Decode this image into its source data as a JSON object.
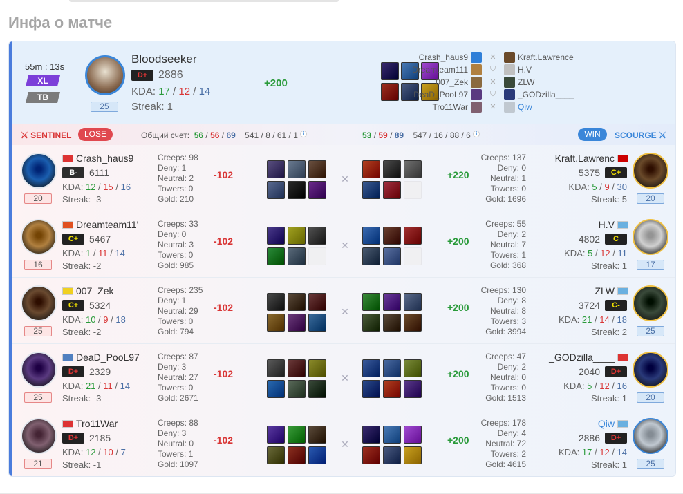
{
  "section_title": "Инфа о матче",
  "summary": {
    "duration": "55m : 13s",
    "mode_tag": "XL",
    "mode_tag_color": "#7c3fd9",
    "map_tag": "TB",
    "map_tag_color": "#7b7b7b",
    "hero_level": "25",
    "player_name": "Bloodseeker",
    "rank": "D+",
    "mmr": "2886",
    "kda_label": "KDA:",
    "kills": "17",
    "deaths": "12",
    "assists": "14",
    "streak": "Streak: 1",
    "delta": "+200",
    "item_colors": [
      "#3a2a6e",
      "#4a7ab5",
      "#a04ad0",
      "#9c3020",
      "#4a5a80",
      "#c8a020"
    ]
  },
  "players_list": {
    "left": [
      {
        "name": "Crash_haus9",
        "color": "#2f7fd8"
      },
      {
        "name": "Dreamteam111",
        "color": "#b08040"
      },
      {
        "name": "007_Zek",
        "color": "#8a6a40"
      },
      {
        "name": "DeaD_PooL97",
        "color": "#5a3a80"
      },
      {
        "name": "Tro11War",
        "color": "#806070"
      }
    ],
    "right": [
      {
        "name": "Kraft.Lawrence",
        "color": "#6a4a2a",
        "self": false
      },
      {
        "name": "H.V",
        "color": "#c0c0c0",
        "self": false
      },
      {
        "name": "ZLW",
        "color": "#3a4a3a",
        "self": false
      },
      {
        "name": "_GODzilla____",
        "color": "#2a3a7a",
        "self": false
      },
      {
        "name": "Qiw",
        "color": "#c0c8d0",
        "self": true
      }
    ]
  },
  "teambar": {
    "sentinel": "SENTINEL",
    "result_left": "LOSE",
    "score_label": "Общий счет:",
    "left_score": {
      "k": "56",
      "d": "56",
      "a": "69"
    },
    "left_totals": "541 / 8 / 61 / 1",
    "right_score": {
      "k": "53",
      "d": "59",
      "a": "89"
    },
    "right_totals": "547 / 16 / 88 / 6",
    "result_right": "WIN",
    "scourge": "SCOURGE",
    "sentinel_color": "#d93636",
    "scourge_color": "#3a86d9"
  },
  "rows": [
    {
      "left": {
        "name": "Crash_haus9",
        "rank": "B-",
        "rank_class": "rank-b",
        "mmr": "6111",
        "k": "12",
        "d": "15",
        "a": "16",
        "streak": "Streak: -3",
        "level": "20",
        "hero_color": "#1b5fb0",
        "creeps": "Creeps: 98",
        "deny": "Deny: 1",
        "neutral": "Neutral: 2",
        "towers": "Towers: 0",
        "gold": "Gold: 210",
        "delta": "-102",
        "items": [
          "#5a5080",
          "#6a7a90",
          "#6a5040",
          "#5a6a90",
          "#2a2a2a",
          "#6a2a8a"
        ],
        "flag": "#d33"
      },
      "right": {
        "name": "Kraft.Lawrenc",
        "rank": "C+",
        "rank_class": "rank-c",
        "mmr": "5375",
        "k": "5",
        "d": "9",
        "a": "30",
        "streak": "Streak: 5",
        "level": "20",
        "hero_color": "#6a4a2a",
        "creeps": "Creeps: 137",
        "deny": "Deny: 0",
        "neutral": "Neutral: 1",
        "towers": "Towers: 0",
        "gold": "Gold: 1696",
        "delta": "+220",
        "items": [
          "#b04020",
          "#4a4a4a",
          "#707070",
          "#3a5a90",
          "#a03040",
          ""
        ],
        "flag": "#c00"
      }
    },
    {
      "left": {
        "name": "Dreamteam11'",
        "rank": "C+",
        "rank_class": "rank-c",
        "mmr": "5467",
        "k": "1",
        "d": "11",
        "a": "14",
        "streak": "Streak: -2",
        "level": "16",
        "hero_color": "#b08040",
        "creeps": "Creeps: 33",
        "deny": "Deny: 0",
        "neutral": "Neutral: 3",
        "towers": "Towers: 0",
        "gold": "Gold: 985",
        "delta": "-102",
        "items": [
          "#4a3a8a",
          "#a0a020",
          "#505050",
          "#2a8a3a",
          "#5a6a7a",
          ""
        ],
        "flag": "#e05020"
      },
      "right": {
        "name": "H.V",
        "rank": "C",
        "rank_class": "rank-c",
        "mmr": "4802",
        "k": "5",
        "d": "12",
        "a": "11",
        "streak": "Streak: 1",
        "level": "17",
        "hero_color": "#d0d0d0",
        "creeps": "Creeps: 55",
        "deny": "Deny: 2",
        "neutral": "Neutral: 7",
        "towers": "Towers: 1",
        "gold": "Gold: 368",
        "delta": "+200",
        "items": [
          "#3a6ab0",
          "#6a4030",
          "#a03030",
          "#4a5a70",
          "#5a70a0",
          ""
        ],
        "flag": "#6ab0e0"
      }
    },
    {
      "left": {
        "name": "007_Zek",
        "rank": "C+",
        "rank_class": "rank-c",
        "mmr": "5324",
        "k": "10",
        "d": "9",
        "a": "18",
        "streak": "Streak: -2",
        "level": "25",
        "hero_color": "#6a4a30",
        "creeps": "Creeps: 235",
        "deny": "Deny: 1",
        "neutral": "Neutral: 29",
        "towers": "Towers: 0",
        "gold": "Gold: 794",
        "delta": "-102",
        "items": [
          "#4a4a4a",
          "#5a4a3a",
          "#6a3a3a",
          "#8a6a30",
          "#6a3a7a",
          "#3a6a9a"
        ],
        "flag": "#f0d020"
      },
      "right": {
        "name": "ZLW",
        "rank": "C-",
        "rank_class": "rank-c",
        "mmr": "3724",
        "k": "21",
        "d": "14",
        "a": "18",
        "streak": "Streak: 2",
        "level": "25",
        "hero_color": "#3a4a3a",
        "creeps": "Creeps: 130",
        "deny": "Deny: 8",
        "neutral": "Neutral: 8",
        "towers": "Towers: 3",
        "gold": "Gold: 3994",
        "delta": "+200",
        "items": [
          "#3a8a3a",
          "#6a3a9a",
          "#5a6a8a",
          "#4a5a3a",
          "#5a4a3a",
          "#6a4a2a"
        ],
        "flag": "#6ab0e0"
      }
    },
    {
      "left": {
        "name": "DeaD_PooL97",
        "rank": "D+",
        "rank_class": "rank-d",
        "mmr": "2329",
        "k": "21",
        "d": "11",
        "a": "14",
        "streak": "Streak: -3",
        "level": "25",
        "hero_color": "#5a3a80",
        "creeps": "Creeps: 87",
        "deny": "Deny: 3",
        "neutral": "Neutral: 27",
        "towers": "Towers: 0",
        "gold": "Gold: 2671",
        "delta": "-102",
        "items": [
          "#5a5a5a",
          "#6a3a3a",
          "#8a8a2a",
          "#2a6ab0",
          "#5a6a5a",
          "#3a4a3a"
        ],
        "flag": "#5080c0"
      },
      "right": {
        "name": "_GODzilla____",
        "rank": "D+",
        "rank_class": "rank-d",
        "mmr": "2040",
        "k": "5",
        "d": "12",
        "a": "16",
        "streak": "Streak: 1",
        "level": "20",
        "hero_color": "#2a3a7a",
        "creeps": "Creeps: 47",
        "deny": "Deny: 2",
        "neutral": "Neutral: 0",
        "towers": "Towers: 0",
        "gold": "Gold: 1513",
        "delta": "+200",
        "items": [
          "#3a5a9a",
          "#4a6aa0",
          "#7a8a3a",
          "#2a4a8a",
          "#b04020",
          "#5a3a8a"
        ],
        "flag": "#d33"
      }
    },
    {
      "left": {
        "name": "Tro11War",
        "rank": "D+",
        "rank_class": "rank-d",
        "mmr": "2185",
        "k": "12",
        "d": "10",
        "a": "7",
        "streak": "Streak: -1",
        "level": "21",
        "hero_color": "#806070",
        "creeps": "Creeps: 88",
        "deny": "Deny: 3",
        "neutral": "Neutral: 0",
        "towers": "Towers: 1",
        "gold": "Gold: 1097",
        "delta": "-102",
        "items": [
          "#5a3aa0",
          "#3a9a3a",
          "#5a4a3a",
          "#6a6a3a",
          "#8a3020",
          "#2a5ab0"
        ],
        "flag": "#d33"
      },
      "right": {
        "name": "Qiw",
        "rank": "D+",
        "rank_class": "rank-d",
        "mmr": "2886",
        "k": "17",
        "d": "12",
        "a": "14",
        "streak": "Streak: 1",
        "level": "25",
        "hero_color": "#c0c8d0",
        "creeps": "Creeps: 178",
        "deny": "Deny: 4",
        "neutral": "Neutral: 72",
        "towers": "Towers: 2",
        "gold": "Gold: 4615",
        "delta": "+200",
        "items": [
          "#3a2a6e",
          "#4a7ab5",
          "#a04ad0",
          "#9c3020",
          "#4a5a80",
          "#c8a020"
        ],
        "flag": "#6ab0e0",
        "self": true
      }
    }
  ]
}
